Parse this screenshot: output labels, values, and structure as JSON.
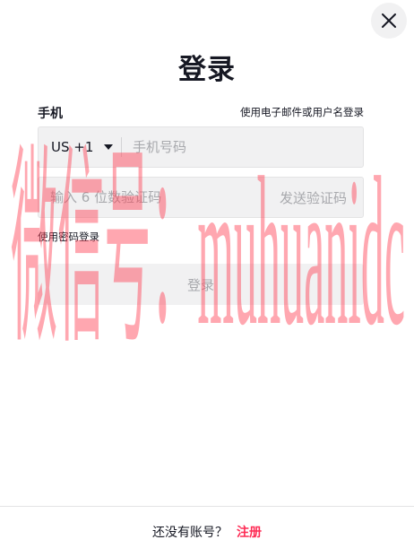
{
  "header": {
    "title": "登录",
    "close_icon": "close-icon"
  },
  "phone_section": {
    "label": "手机",
    "alt_login_link": "使用电子邮件或用户名登录",
    "country_code": "US +1",
    "phone_placeholder": "手机号码"
  },
  "code_section": {
    "code_placeholder": "输入 6 位数验证码",
    "send_code_label": "发送验证码"
  },
  "password_login_link": "使用密码登录",
  "submit_label": "登录",
  "footer": {
    "prompt": "还没有账号？",
    "signup_label": "注册"
  },
  "watermark_text": "微信号：muhuanidc",
  "colors": {
    "accent": "#fe2c55",
    "field_bg": "#f1f1f2",
    "watermark": "#ff3b4f"
  }
}
